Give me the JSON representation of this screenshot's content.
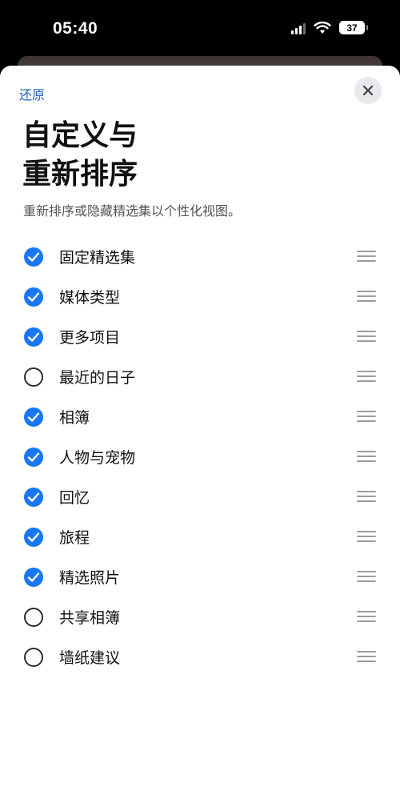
{
  "status_bar": {
    "time": "05:40",
    "battery_level": "37"
  },
  "sheet": {
    "reset_label": "还原",
    "title_line1": "自定义与",
    "title_line2": "重新排序",
    "subtitle": "重新排序或隐藏精选集以个性化视图。"
  },
  "items": [
    {
      "label": "固定精选集",
      "checked": true
    },
    {
      "label": "媒体类型",
      "checked": true
    },
    {
      "label": "更多项目",
      "checked": true
    },
    {
      "label": "最近的日子",
      "checked": false
    },
    {
      "label": "相簿",
      "checked": true
    },
    {
      "label": "人物与宠物",
      "checked": true
    },
    {
      "label": "回忆",
      "checked": true
    },
    {
      "label": "旅程",
      "checked": true
    },
    {
      "label": "精选照片",
      "checked": true
    },
    {
      "label": "共享相簿",
      "checked": false
    },
    {
      "label": "墙纸建议",
      "checked": false
    }
  ],
  "colors": {
    "accent": "#1877f2",
    "link": "#1f5fbf"
  }
}
